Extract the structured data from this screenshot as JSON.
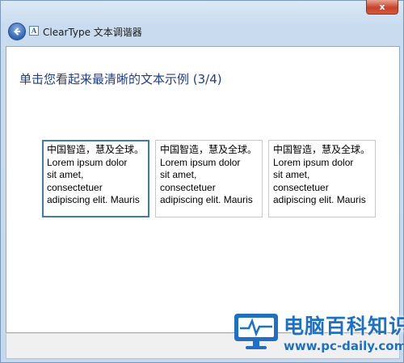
{
  "window": {
    "title": "ClearType 文本调谐器",
    "app_icon_glyph": "A",
    "close_glyph": "x"
  },
  "main": {
    "instruction": "单击您看起来最清晰的文本示例 (3/4)",
    "samples": [
      {
        "lines": [
          "中国智造，慧及全球。",
          "Lorem ipsum dolor",
          "sit amet,",
          "consectetuer",
          "adipiscing elit. Mauris"
        ],
        "selected": true
      },
      {
        "lines": [
          "中国智造，慧及全球。",
          "Lorem ipsum dolor",
          "sit amet,",
          "consectetuer",
          "adipiscing elit. Mauris"
        ],
        "selected": false
      },
      {
        "lines": [
          "中国智造，慧及全球。",
          "Lorem ipsum dolor",
          "sit amet,",
          "consectetuer",
          "adipiscing elit. Mauris"
        ],
        "selected": false
      }
    ]
  },
  "watermark": {
    "title": "电脑百科知识",
    "url": "www.pc-daily.com"
  },
  "colors": {
    "instruction_text": "#1e3d8a",
    "selection_border": "#3d7bb8",
    "watermark_blue": "#1d6fc7"
  }
}
